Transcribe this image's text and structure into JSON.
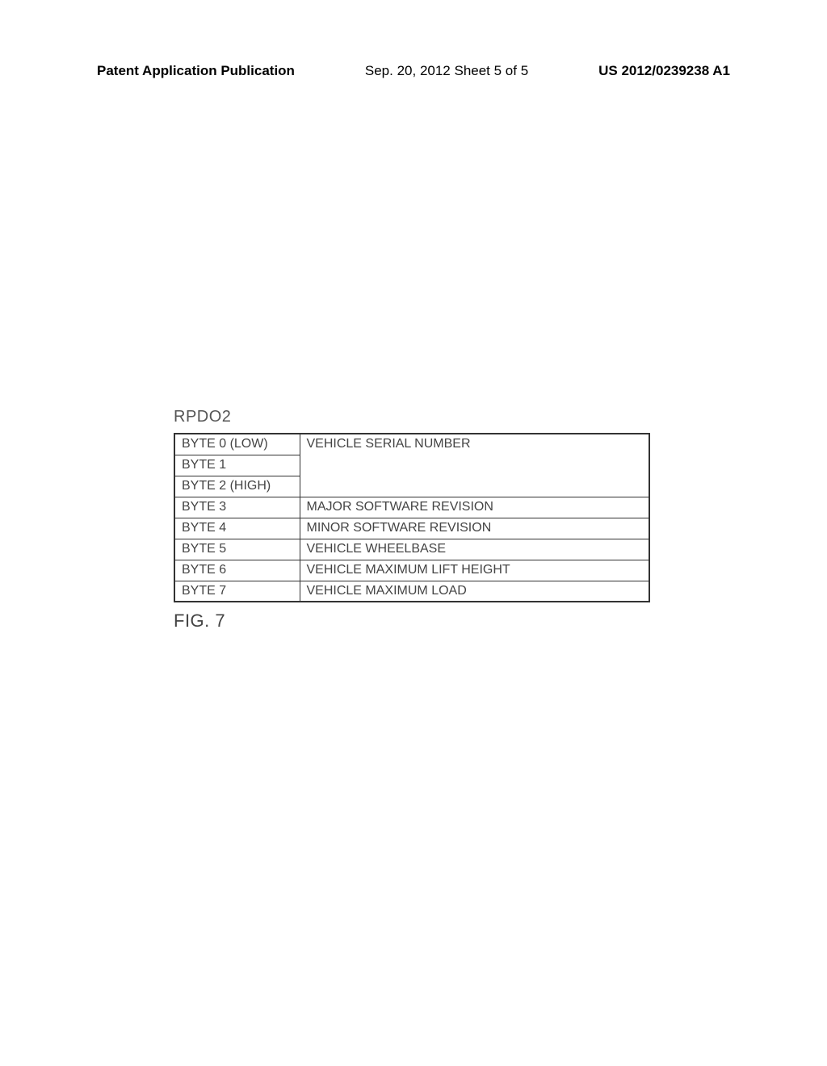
{
  "header": {
    "left": "Patent Application Publication",
    "center": "Sep. 20, 2012  Sheet 5 of 5",
    "right": "US 2012/0239238 A1"
  },
  "table": {
    "title": "RPDO2",
    "rows": [
      {
        "byte": "BYTE 0 (LOW)",
        "desc": "VEHICLE SERIAL NUMBER"
      },
      {
        "byte": "BYTE 1",
        "desc": ""
      },
      {
        "byte": "BYTE 2 (HIGH)",
        "desc": ""
      },
      {
        "byte": "BYTE 3",
        "desc": "MAJOR SOFTWARE REVISION"
      },
      {
        "byte": "BYTE 4",
        "desc": "MINOR SOFTWARE REVISION"
      },
      {
        "byte": "BYTE 5",
        "desc": "VEHICLE WHEELBASE"
      },
      {
        "byte": "BYTE 6",
        "desc": "VEHICLE MAXIMUM LIFT HEIGHT"
      },
      {
        "byte": "BYTE 7",
        "desc": "VEHICLE MAXIMUM LOAD"
      }
    ]
  },
  "figure_label": "FIG. 7"
}
